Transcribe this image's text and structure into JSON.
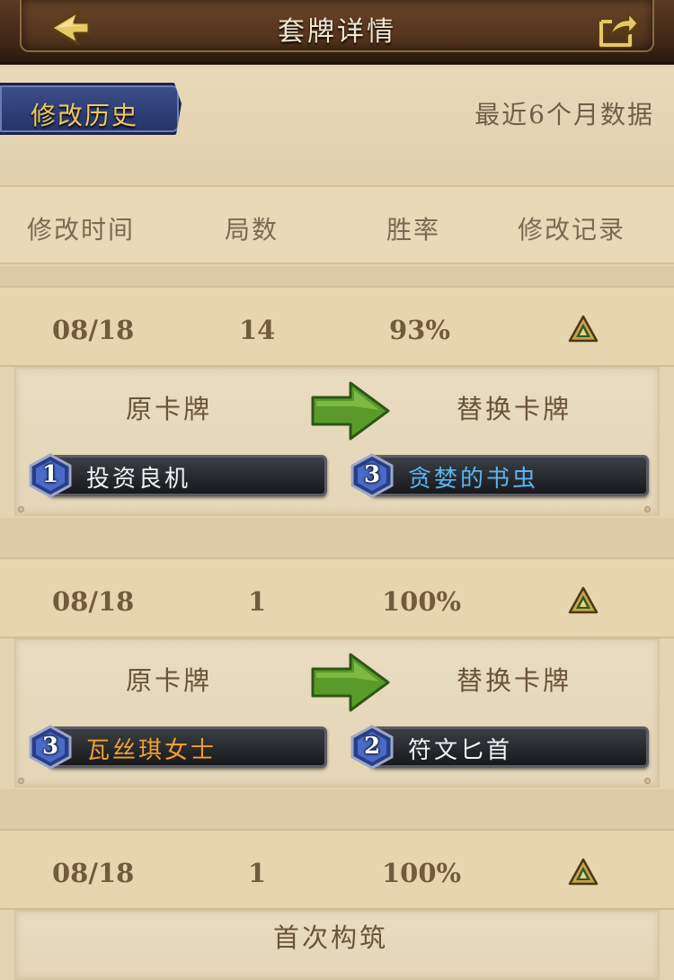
{
  "header": {
    "title": "套牌详情",
    "back_icon": "back-arrow-icon",
    "share_icon": "share-icon"
  },
  "tabs": {
    "history": "修改历史",
    "recent": "最近6个月数据"
  },
  "columns": [
    "修改时间",
    "局数",
    "胜率",
    "修改记录"
  ],
  "colors": {
    "rare_blue": "#5ab4f0",
    "legendary_orange": "#f0a030",
    "common_white": "#f2f2f2",
    "arrow_green": "#5a9a2a",
    "tab_blue": "#2d3c78"
  },
  "rows": [
    {
      "date": "08/18",
      "games": "14",
      "winrate": "93%",
      "detail": {
        "original_label": "原卡牌",
        "replacement_label": "替换卡牌",
        "original_card": {
          "cost": "1",
          "name": "投资良机",
          "color": "#f2f2f2"
        },
        "replacement_card": {
          "cost": "3",
          "name": "贪婪的书虫",
          "color": "#5ab4f0"
        }
      }
    },
    {
      "date": "08/18",
      "games": "1",
      "winrate": "100%",
      "detail": {
        "original_label": "原卡牌",
        "replacement_label": "替换卡牌",
        "original_card": {
          "cost": "3",
          "name": "瓦丝琪女士",
          "color": "#f0a030"
        },
        "replacement_card": {
          "cost": "2",
          "name": "符文匕首",
          "color": "#f2f2f2"
        }
      }
    },
    {
      "date": "08/18",
      "games": "1",
      "winrate": "100%",
      "detail": {
        "note": "首次构筑"
      }
    }
  ]
}
